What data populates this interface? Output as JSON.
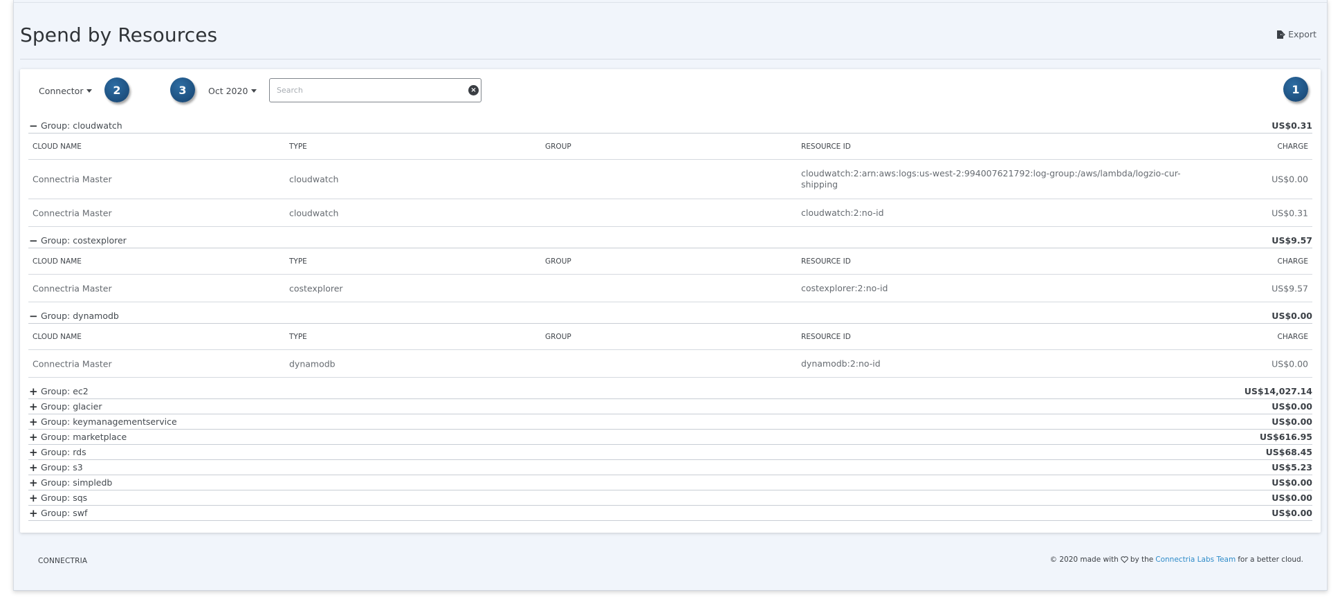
{
  "page": {
    "title": "Spend by Resources",
    "export_label": "Export"
  },
  "toolbar": {
    "connector_label": "Connector",
    "month_label": "Oct 2020",
    "search_placeholder": "Search",
    "badges": [
      "2",
      "3",
      "1"
    ]
  },
  "columns": {
    "cloud_name": "CLOUD NAME",
    "type": "TYPE",
    "group": "GROUP",
    "resource_id": "RESOURCE ID",
    "charge": "CHARGE"
  },
  "groups": [
    {
      "label": "Group: cloudwatch",
      "total": "US$0.31",
      "expanded": true,
      "toggle": "−",
      "rows": [
        {
          "cloud_name": "Connectria Master",
          "type": "cloudwatch",
          "group": "",
          "resource_id": "cloudwatch:2:arn:aws:logs:us-west-2:994007621792:log-group:/aws/lambda/logzio-cur-shipping",
          "charge": "US$0.00"
        },
        {
          "cloud_name": "Connectria Master",
          "type": "cloudwatch",
          "group": "",
          "resource_id": "cloudwatch:2:no-id",
          "charge": "US$0.31"
        }
      ]
    },
    {
      "label": "Group: costexplorer",
      "total": "US$9.57",
      "expanded": true,
      "toggle": "−",
      "rows": [
        {
          "cloud_name": "Connectria Master",
          "type": "costexplorer",
          "group": "",
          "resource_id": "costexplorer:2:no-id",
          "charge": "US$9.57"
        }
      ]
    },
    {
      "label": "Group: dynamodb",
      "total": "US$0.00",
      "expanded": true,
      "toggle": "−",
      "rows": [
        {
          "cloud_name": "Connectria Master",
          "type": "dynamodb",
          "group": "",
          "resource_id": "dynamodb:2:no-id",
          "charge": "US$0.00"
        }
      ]
    },
    {
      "label": "Group: ec2",
      "total": "US$14,027.14",
      "expanded": false,
      "toggle": "+"
    },
    {
      "label": "Group: glacier",
      "total": "US$0.00",
      "expanded": false,
      "toggle": "+"
    },
    {
      "label": "Group: keymanagementservice",
      "total": "US$0.00",
      "expanded": false,
      "toggle": "+"
    },
    {
      "label": "Group: marketplace",
      "total": "US$616.95",
      "expanded": false,
      "toggle": "+"
    },
    {
      "label": "Group: rds",
      "total": "US$68.45",
      "expanded": false,
      "toggle": "+"
    },
    {
      "label": "Group: s3",
      "total": "US$5.23",
      "expanded": false,
      "toggle": "+"
    },
    {
      "label": "Group: simpledb",
      "total": "US$0.00",
      "expanded": false,
      "toggle": "+"
    },
    {
      "label": "Group: sqs",
      "total": "US$0.00",
      "expanded": false,
      "toggle": "+"
    },
    {
      "label": "Group: swf",
      "total": "US$0.00",
      "expanded": false,
      "toggle": "+"
    }
  ],
  "footer": {
    "brand": "CONNECTRIA",
    "prefix": "© 2020 made with",
    "middle": "by the",
    "link": "Connectria Labs Team",
    "suffix": "for a better cloud."
  },
  "colors": {
    "badge": "#1d4f7e",
    "link": "#2e8bc9",
    "page_bg": "#f1f5fb"
  }
}
